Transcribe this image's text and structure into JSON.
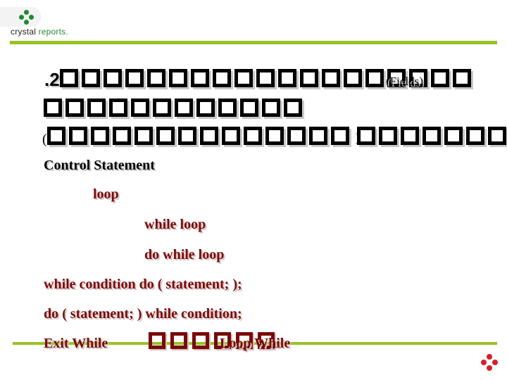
{
  "brand": {
    "name_part1": "crystal",
    "name_part2": " reports.",
    "accent_green": "#99c224",
    "logo_green": "#1f8a2f",
    "logo_red": "#d71f2a",
    "text_maroon": "#7a0a0a"
  },
  "slide": {
    "heading": {
      "prefix": ".2",
      "missing_glyph_count_line1": 19,
      "fields_label": "(Fields)",
      "missing_glyph_count_line2": 12,
      "open_paren": "(",
      "missing_glyph_count_line3a": 14,
      "close_paren": ")",
      "missing_glyph_count_line3b": 7
    },
    "section_title": "Control Statement",
    "items": [
      {
        "text": "loop"
      },
      {
        "text": "while loop"
      },
      {
        "text": "do while loop"
      },
      {
        "text": "while condition do ( statement; );"
      },
      {
        "text": "do ( statement; ) while condition;"
      }
    ],
    "last_line": {
      "left": "Exit While",
      "missing_glyph_count": 6,
      "right": "Loop While"
    }
  }
}
